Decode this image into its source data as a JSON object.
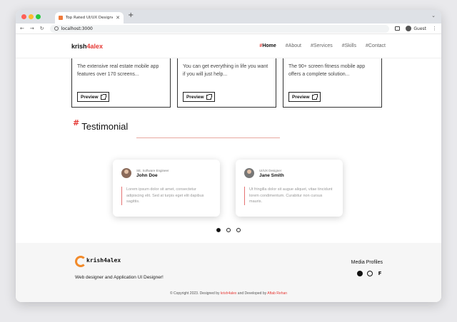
{
  "browser": {
    "tab_title": "Top Rated UI/UX Designer - K",
    "url": "localhost:3000",
    "profile_label": "Guest",
    "traffic_colors": [
      "#ff5f57",
      "#febc2e",
      "#28c840"
    ]
  },
  "site": {
    "logo_main": "krish",
    "logo_accent": "4alex",
    "accent_color": "#e53935",
    "nav": [
      {
        "label": "Home",
        "active": true
      },
      {
        "label": "About",
        "active": false
      },
      {
        "label": "Services",
        "active": false
      },
      {
        "label": "Skills",
        "active": false
      },
      {
        "label": "Contact",
        "active": false
      }
    ]
  },
  "projects": [
    {
      "desc": "The extensive real estate mobile app features over 170 screens...",
      "button": "Preview"
    },
    {
      "desc": "You can get everything in life you want if you will just help...",
      "button": "Preview"
    },
    {
      "desc": "The 90+ screen fitness mobile app offers a complete solution...",
      "button": "Preview"
    }
  ],
  "testimonial": {
    "heading": "Testimonial",
    "items": [
      {
        "role": "SE, Software Engineer",
        "name": "John Doe",
        "quote": "Lorem ipsum dolor sit amet, consectetur adipiscing elit. Sed at turpis eget elit dapibus sagittis."
      },
      {
        "role": "UI/UX Designer",
        "name": "Jane Smith",
        "quote": "Ut fringilla dolor sit augue aliquet, vitae tincidunt lorem condimentum. Curabitur non cursus mauris."
      }
    ],
    "pagination_active": 0
  },
  "footer": {
    "logo_text": "krish4alex",
    "tagline": "Web designer and Application UI Designer!",
    "media_title": "Media Profiles",
    "social_icons": [
      "github-icon",
      "dribbble-icon",
      "figma-icon"
    ],
    "copyright_prefix": "© Copyright 2023. Designed by",
    "designer": "krish4alex",
    "copyright_mid": "and Developed by",
    "developer": "Aftab Rehan"
  }
}
